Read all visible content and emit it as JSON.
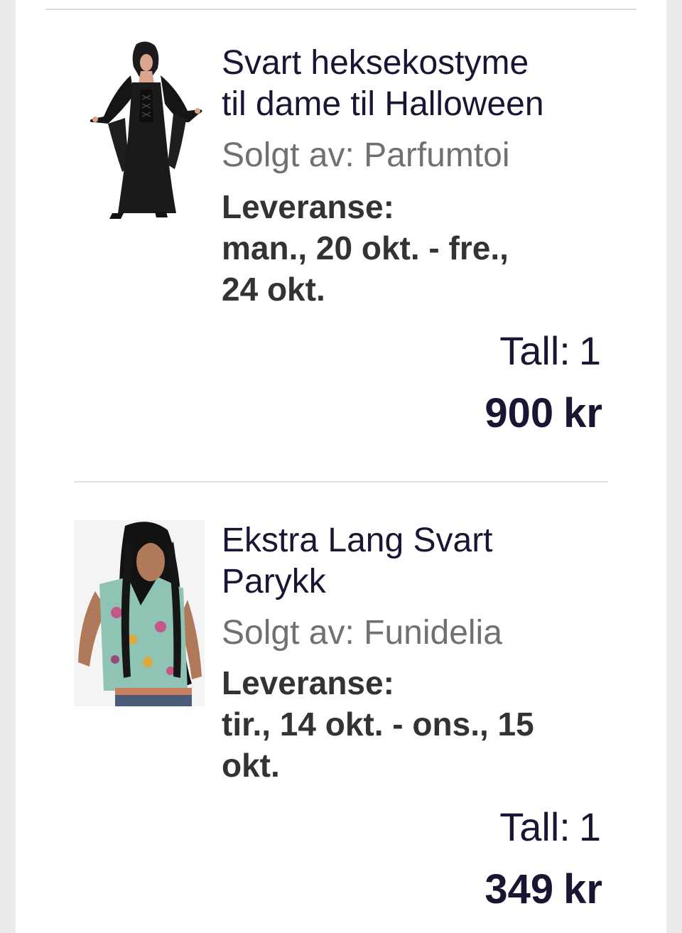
{
  "cart": {
    "items": [
      {
        "image_alt": "Svart heksekostyme",
        "title_line1": "Svart heksekostyme",
        "title_line2": "til dame til Halloween",
        "seller_label": "Solgt av:",
        "seller_name": "Parfumtoi",
        "delivery_label": "Leveranse:",
        "delivery_line1": "man., 20 okt. - fre.,",
        "delivery_line2": "24 okt.",
        "qty_label": "Tall:",
        "qty_value": "1",
        "price_value": "900",
        "price_currency": "kr"
      },
      {
        "image_alt": "Ekstra Lang Svart Parykk",
        "title_line1": "Ekstra Lang Svart",
        "title_line2": "Parykk",
        "seller_label": "Solgt av:",
        "seller_name": "Funidelia",
        "delivery_label": "Leveranse:",
        "delivery_line1": "tir., 14 okt. - ons., 15",
        "delivery_line2": "okt.",
        "qty_label": "Tall:",
        "qty_value": "1",
        "price_value": "349",
        "price_currency": "kr"
      }
    ]
  },
  "colors": {
    "text_primary": "#1a1533",
    "text_secondary": "#707070",
    "text_delivery": "#333333",
    "divider": "#dcdcdc",
    "page_background": "#ebebeb"
  }
}
